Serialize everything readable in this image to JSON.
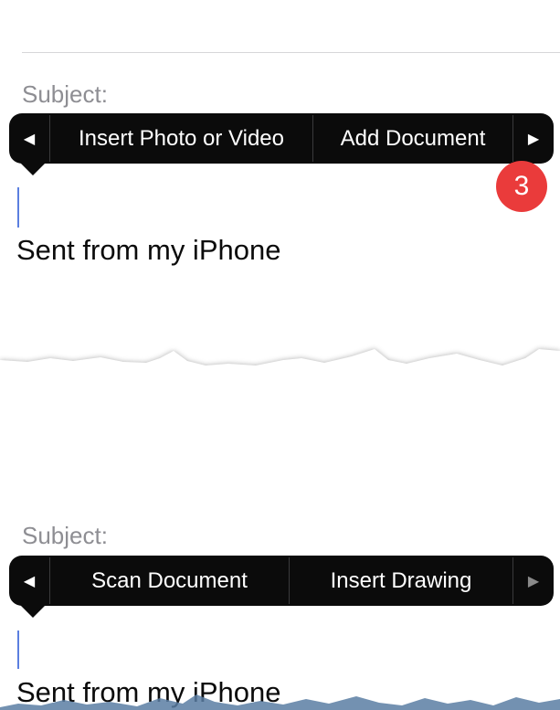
{
  "panel_top": {
    "subject_label": "Subject:",
    "menu": {
      "left_arrow": "◀",
      "items": [
        "Insert Photo or Video",
        "Add Document"
      ],
      "right_arrow": "▶"
    },
    "step_badge": "3",
    "body_text": "Sent from my iPhone"
  },
  "panel_bottom": {
    "subject_label": "Subject:",
    "menu": {
      "left_arrow": "◀",
      "items": [
        "Scan Document",
        "Insert Drawing"
      ],
      "right_arrow": "▶"
    },
    "body_text": "Sent from my iPhone"
  },
  "colors": {
    "menu_bg": "#0b0b0b",
    "badge": "#ea3b3b",
    "cursor": "#5b7fe0",
    "label": "#8e8e93"
  },
  "icons": {
    "left_arrow": "triangle-left-icon",
    "right_arrow": "triangle-right-icon"
  }
}
